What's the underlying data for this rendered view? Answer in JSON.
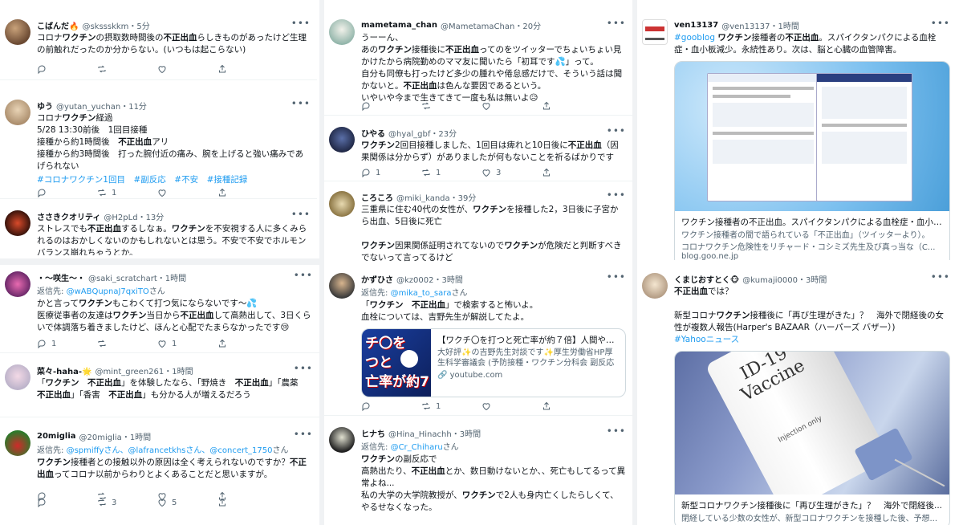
{
  "colors": {
    "accent": "#1d9bf0",
    "text": "#0f1419",
    "muted": "#536471",
    "highlight": "#cfe6fb"
  },
  "tweets": [
    {
      "name": "こばんだ🔥",
      "handle": "@skssskkm",
      "time": "5分",
      "text_html": "コロナ<b>ワクチン</b>の摂取数時間後の<b>不正出血</b>らしきものがあったけど生理の前触れだったのか分からない。(いつもは起こらない)",
      "counts": {
        "reply": "",
        "retweet": "",
        "like": ""
      }
    },
    {
      "name": "ゆう",
      "handle": "@yutan_yuchan",
      "time": "11分",
      "text_html": "コロナ<b>ワクチン</b>経過<br>5/28 13:30前後　1回目接種<br>接種から約1時間後　<b>不正出血</b>アリ<br>接種から約3時間後　打った腕付近の痛み、腕を上げると強い痛みであげられない",
      "hashtags": "#コロナワクチン1回目　#副反応　#不安　#接種記録",
      "counts": {
        "reply": "",
        "retweet": "1",
        "like": ""
      }
    },
    {
      "name": "ささきクオリティ",
      "handle": "@H2pLd",
      "time": "13分",
      "text_html": "ストレスでも<b>不正出血</b>するしなぁ。<b>ワクチン</b>を不安視する人に多くみられるのはおかしくないのかもしれないとは思う。不安で不安でホルモンバランス崩れちゃうとか。"
    },
    {
      "name": "mametama_chan",
      "handle": "@MametamaChan",
      "time": "20分",
      "text_html": "うーーん、<br>あの<b>ワクチン</b>接種後に<b>不正出血</b>ってのをツイッターでちょいちょい見かけたから病院勤めのママ友に聞いたら「初耳です💦」って。<br>自分も同僚も打ったけど多少の腫れや倦怠感だけで、そういう話は聞かないと。<b>不正出血</b>は色んな要因であるという。<br>いやいや今まで生きてきて一度も私は無いよ😥",
      "counts": {
        "reply": "",
        "retweet": "",
        "like": ""
      }
    },
    {
      "name": "ひやる",
      "handle": "@hyal_gbf",
      "time": "23分",
      "text_html": "<b>ワクチン</b>2回目接種しました、1回目は痺れと10日後に<b>不正出血</b>（因果関係は分からず）がありましたが何もないことを祈るばかりです",
      "counts": {
        "reply": "1",
        "retweet": "1",
        "like": "3"
      }
    },
    {
      "name": "ころころ",
      "handle": "@miki_kanda",
      "time": "39分",
      "text_html": "三重県に住む40代の女性が、<b>ワクチン</b>を接種した2，3日後に子宮から出血、5日後に死亡<br><br><b>ワクチン</b>因果関係証明されてないので<b>ワクチン</b>が危険だと判断すべきでないって言ってるけど"
    },
    {
      "name": "ven13137",
      "handle": "@ven13137",
      "time": "1時間",
      "text_html": "<span class=\"hashtags\">#gooblog</span> <b>ワクチン</b>接種者の<b>不正出血</b>。スパイクタンパクによる血栓症・血小板減少。永続性あり。次は、脳と心臓の血管障害。",
      "card_title": "ワクチン接種者の不正出血。スパイクタンパクによる血栓症・血小板...",
      "card_desc1": "ワクチン接種者の間で語られている「不正出血」（ツイッターより）。",
      "card_desc2": "コロナワクチン危険性をリチャード・コシミズ先生及び真っ当な（C...",
      "card_domain": "blog.goo.ne.jp"
    },
    {
      "name": "・〜咲生〜・",
      "handle": "@saki_scratchart",
      "time": "1時間",
      "reply_label": "返信先: ",
      "reply_to": "@wABQupnaJ7qxiTO",
      "reply_suffix": "さん",
      "text_html": "かと言って<b>ワクチン</b>もこわくて打つ気にならないです〜💦<br>医療従事者の友達は<b>ワクチン</b>当日から<b>不正出血</b>して高熱出して、3日くらいで体調落ち着きましたけど、ほんと心配でたまらなかったです😢",
      "counts": {
        "reply": "1",
        "retweet": "",
        "like": "1"
      }
    },
    {
      "name": "菜々-haha-🌟",
      "handle": "@mint_green261",
      "time": "1時間",
      "text_html": "「<b>ワクチン　不正出血</b>」を体験したなら、「野焼き　<b>不正出血</b>」「農薬　<b>不正出血</b>」「香害　<b>不正出血</b>」も分かる人が増えるだろう",
      "counts": {
        "reply": "",
        "retweet": "3",
        "like": "5"
      }
    },
    {
      "name": "20miglia",
      "handle": "@20miglia",
      "time": "1時間",
      "reply_label": "返信先: ",
      "reply_to": "@spmiffyさん、@lafrancetkhsさん、@concert_1750",
      "reply_suffix": "さん",
      "text_html": "<b>ワクチン</b>接種者との接触以外の原因は全く考えられないのですか？<b>不正出血</b>ってコロナ以前からわりとよくあることだと思いますが。"
    },
    {
      "name": "かずひさ",
      "handle": "@kz0002",
      "time": "3時間",
      "reply_label": "返信先: ",
      "reply_to": "@mika_to_sara",
      "reply_suffix": "さん",
      "text_html": "「<b>ワクチン　不正出血</b>」で検索すると怖いよ。<br>血栓については、吉野先生が解説してたよ。",
      "card_title": "【ワクチ〇を打つと死亡率が約７倍】人間やめま...",
      "card_desc": "大好評✨の吉野先生対談です✨厚生労働省HP厚生科学審議会 (予防接種・ワクチン分科会 副反応検...",
      "card_domain": "🔗 youtube.com",
      "thumb_text": "チ〇を\nつと\n亡率が約7",
      "counts": {
        "reply": "",
        "retweet": "1",
        "like": ""
      }
    },
    {
      "name": "ヒナち",
      "handle": "@Hina_Hinachh",
      "time": "3時間",
      "reply_label": "返信先: ",
      "reply_to": "@Cr_Chiharu",
      "reply_suffix": "さん",
      "text_html": "<b>ワクチン</b>の副反応で<br>高熱出たり、<b>不正出血</b>とか、数日動けないとか、、死亡もしてるって異常よね...<br>私の大学の大学院教授が、<b>ワクチン</b>で2人も身内亡くしたらしくて、やるせなくなった。"
    },
    {
      "name": "くまじおすとく🐵",
      "handle": "@kumaji0000",
      "time": "3時間",
      "text_html": "<b>不正出血</b>では？<br><br>新型コロナ<b>ワクチン</b>接種後に「再び生理がきた」？　海外で閉経後の女性が複数人報告(Harper's BAZAAR（ハーパーズ バザー）)<br><span class=\"hashtags\">#Yahooニュース</span>",
      "vial_label": "ID-19\nVaccine",
      "vial_sub": "Injection only",
      "card_title": "新型コロナワクチン接種後に「再び生理がきた」？　海外で閉経後...",
      "card_desc": "閉経している少数の女性が、新型コロナワクチンを接種した後、予想..."
    }
  ]
}
